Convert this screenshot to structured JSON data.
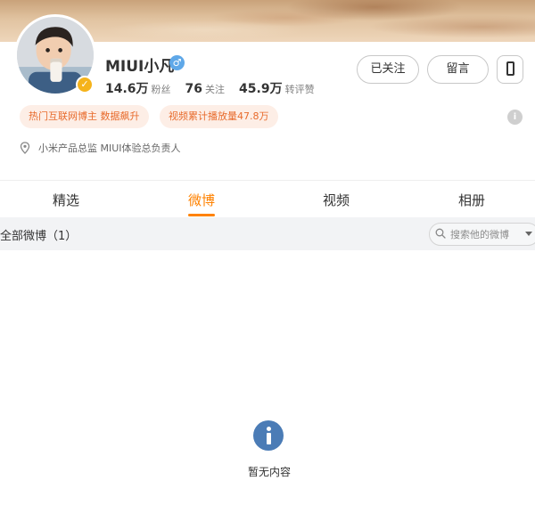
{
  "profile": {
    "name": "MIUI小凡",
    "verified_glyph": "✓",
    "gender_glyph": "♂",
    "stats": [
      {
        "value": "14.6万",
        "label": "粉丝"
      },
      {
        "value": "76",
        "label": "关注"
      },
      {
        "value": "45.9万",
        "label": "转评赞"
      }
    ],
    "tags": [
      "热门互联网博主 数据飙升",
      "视频累计播放量47.8万"
    ],
    "description": "小米产品总监 MIUI体验总负责人"
  },
  "actions": {
    "follow_label": "已关注",
    "message_label": "留言"
  },
  "tabs": [
    {
      "label": "精选",
      "active": false
    },
    {
      "label": "微博",
      "active": true
    },
    {
      "label": "视频",
      "active": false
    },
    {
      "label": "相册",
      "active": false
    }
  ],
  "feed": {
    "title": "全部微博（1）",
    "search_placeholder": "搜索他的微博",
    "empty_text": "暂无内容"
  },
  "colors": {
    "accent": "#ff8200",
    "tag_text": "#e86b2c",
    "tag_bg": "#fdeee6",
    "empty_icon": "#4b7cb6",
    "verified": "#f5b31b"
  },
  "icons": {
    "verified": "verified-badge-icon",
    "gender": "male-icon",
    "phone": "phone-icon",
    "info": "info-icon",
    "location": "location-icon",
    "search": "search-icon",
    "dropdown": "chevron-down-icon",
    "empty": "info-circle-icon"
  }
}
